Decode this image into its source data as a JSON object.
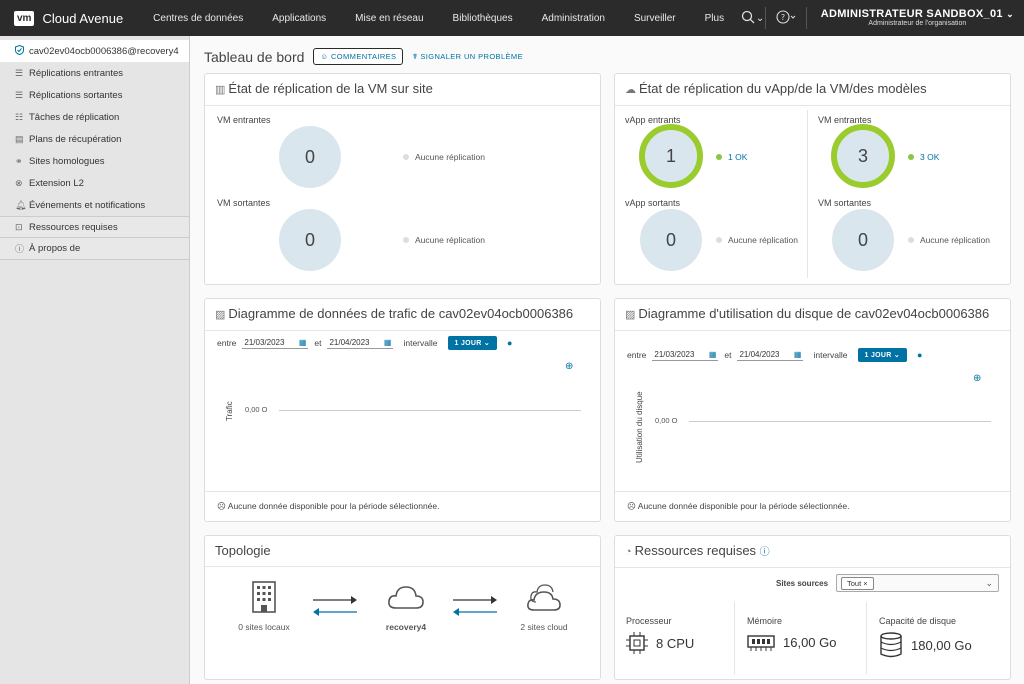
{
  "header": {
    "logo": "vm",
    "brand": "Cloud Avenue",
    "nav": [
      "Centres de données",
      "Applications",
      "Mise en réseau",
      "Bibliothèques",
      "Administration",
      "Surveiller",
      "Plus"
    ],
    "user_name": "ADMINISTRATEUR SANDBOX_01",
    "user_role": "Administrateur de l'organisation"
  },
  "sidebar": {
    "items": [
      {
        "label": "cav02ev04ocb0006386@recovery4",
        "icon": "shield-check-icon"
      },
      {
        "label": "Réplications entrantes",
        "icon": "list-icon"
      },
      {
        "label": "Réplications sortantes",
        "icon": "list-icon"
      },
      {
        "label": "Tâches de réplication",
        "icon": "tasks-icon"
      },
      {
        "label": "Plans de récupération",
        "icon": "plan-icon"
      },
      {
        "label": "Sites homologues",
        "icon": "sites-icon"
      },
      {
        "label": "Extension L2",
        "icon": "extension-icon"
      },
      {
        "label": "Événements et notifications",
        "icon": "bell-icon"
      },
      {
        "label": "Ressources requises",
        "icon": "resources-icon"
      },
      {
        "label": "À propos de",
        "icon": "info-icon"
      }
    ]
  },
  "page": {
    "title": "Tableau de bord",
    "feedback_btn": "COMMENTAIRES",
    "report_link": "SIGNALER UN PROBLÈME"
  },
  "vm_replication": {
    "title": "État de réplication de la VM sur site",
    "incoming_label": "VM entrantes",
    "incoming_value": "0",
    "incoming_legend": "Aucune réplication",
    "outgoing_label": "VM sortantes",
    "outgoing_value": "0",
    "outgoing_legend": "Aucune réplication"
  },
  "vapp_replication": {
    "title": "État de réplication du vApp/de la VM/des modèles",
    "vapp_in_label": "vApp entrants",
    "vapp_in_value": "1",
    "vapp_in_legend": "1 OK",
    "vm_in_label": "VM entrantes",
    "vm_in_value": "3",
    "vm_in_legend": "3 OK",
    "vapp_out_label": "vApp sortants",
    "vapp_out_value": "0",
    "vapp_out_legend": "Aucune réplication",
    "vm_out_label": "VM sortantes",
    "vm_out_value": "0",
    "vm_out_legend": "Aucune réplication"
  },
  "traffic": {
    "title": "Diagramme de données de trafic de cav02ev04ocb0006386",
    "between": "entre",
    "from": "21/03/2023",
    "and": "et",
    "to": "21/04/2023",
    "interval_label": "intervalle",
    "interval": "1 JOUR",
    "ylabel": "Trafic",
    "ytick": "0,00 O",
    "empty": "Aucune donnée disponible pour la période sélectionnée."
  },
  "disk": {
    "title": "Diagramme d'utilisation du disque de cav02ev04ocb0006386",
    "between": "entre",
    "from": "21/03/2023",
    "and": "et",
    "to": "21/04/2023",
    "interval_label": "intervalle",
    "interval": "1 JOUR",
    "ylabel": "Utilisation du disque",
    "ytick": "0,00 O",
    "empty": "Aucune donnée disponible pour la période sélectionnée."
  },
  "topology": {
    "title": "Topologie",
    "local": "0 sites locaux",
    "center": "recovery4",
    "cloud": "2 sites cloud"
  },
  "resources": {
    "title": "Ressources requises",
    "sites_label": "Sites sources",
    "tag": "Tout",
    "cpu_label": "Processeur",
    "cpu_value": "8 CPU",
    "mem_label": "Mémoire",
    "mem_value": "16,00 Go",
    "disk_label": "Capacité de disque",
    "disk_value": "180,00 Go"
  },
  "colors": {
    "topbar": "#2b2b2b",
    "accent": "#0072a3",
    "ok": "#9acc2e",
    "circle": "#dae6ee"
  }
}
